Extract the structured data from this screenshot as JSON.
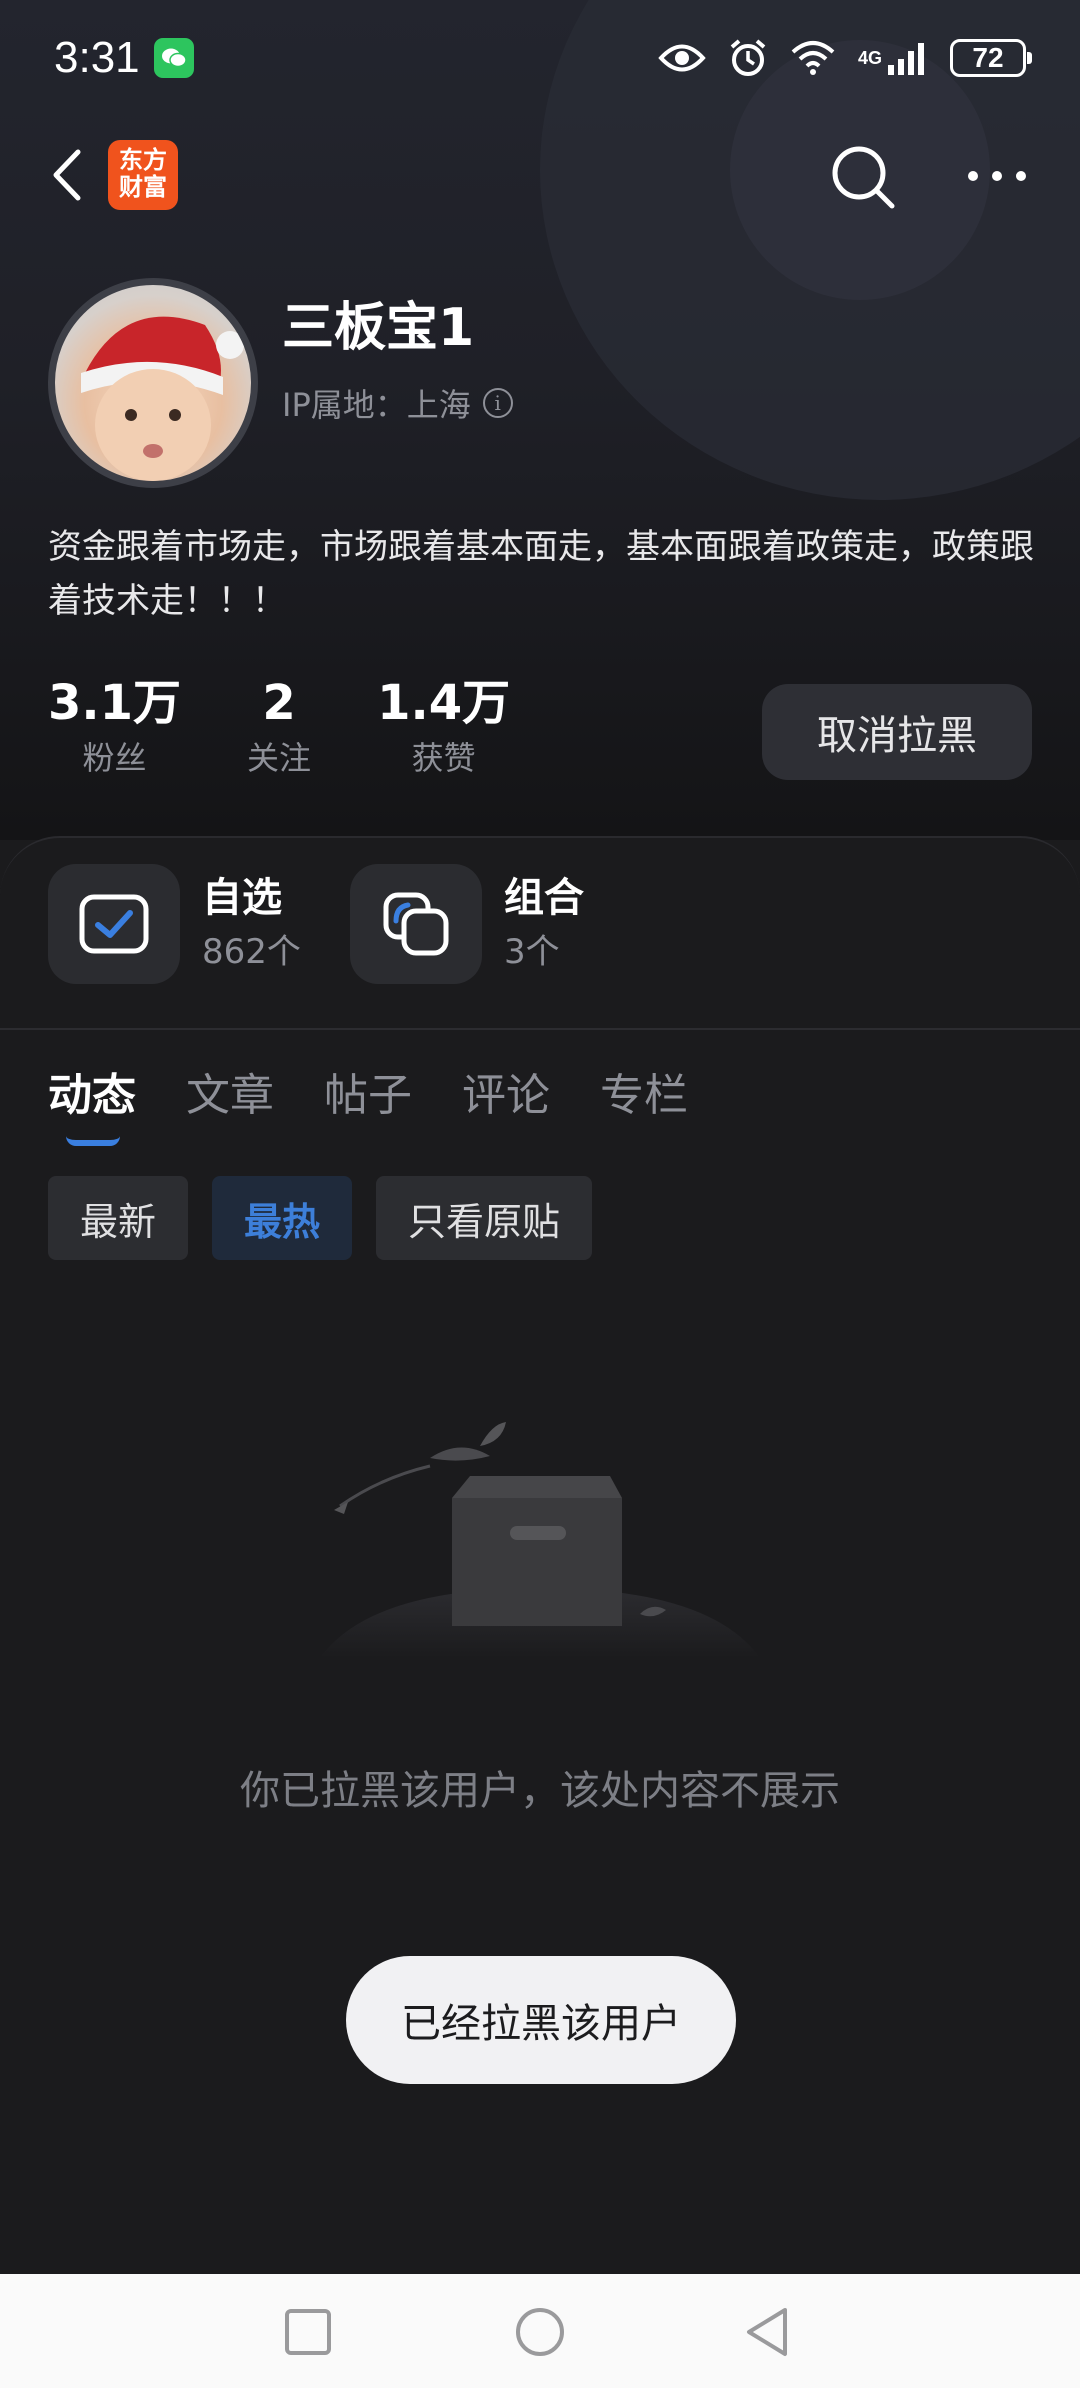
{
  "status_bar": {
    "time": "3:31",
    "network": "4G",
    "battery": "72"
  },
  "app": {
    "logo_text": "东方财富"
  },
  "profile": {
    "name": "三板宝1",
    "ip_location": "IP属地：上海",
    "bio": "资金跟着市场走，市场跟着基本面走，基本面跟着政策走，政策跟着技术走！！！",
    "stats": [
      {
        "value": "3.1万",
        "label": "粉丝"
      },
      {
        "value": "2",
        "label": "关注"
      },
      {
        "value": "1.4万",
        "label": "获赞"
      }
    ],
    "unblock_label": "取消拉黑"
  },
  "quick_links": [
    {
      "title": "自选",
      "sub": "862个"
    },
    {
      "title": "组合",
      "sub": "3个"
    }
  ],
  "tabs": [
    "动态",
    "文章",
    "帖子",
    "评论",
    "专栏"
  ],
  "active_tab": "动态",
  "filters": [
    "最新",
    "最热",
    "只看原贴"
  ],
  "active_filter": "最热",
  "empty_message": "你已拉黑该用户，该处内容不展示",
  "toast": "已经拉黑该用户",
  "colors": {
    "accent": "#3a7fe0",
    "brand": "#f0531d",
    "background": "#1b1b1d"
  }
}
